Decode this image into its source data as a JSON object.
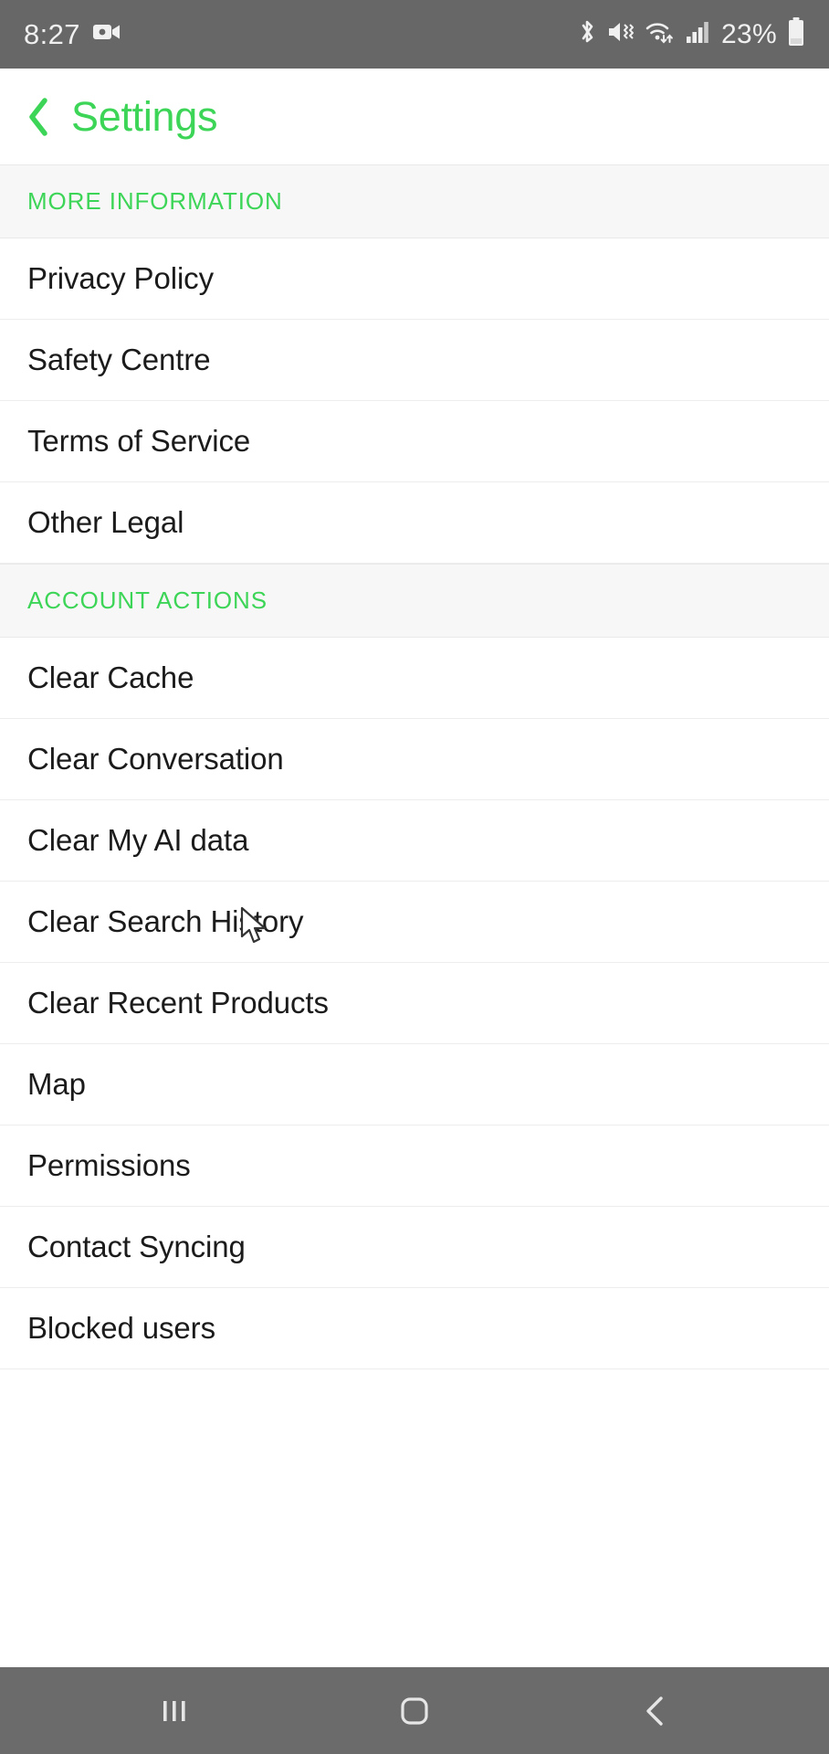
{
  "status_bar": {
    "time": "8:27",
    "battery_percent": "23%",
    "icons": [
      {
        "name": "screen-record-icon"
      },
      {
        "name": "bluetooth-icon"
      },
      {
        "name": "vibrate-mute-icon"
      },
      {
        "name": "wifi-transfer-icon"
      },
      {
        "name": "cellular-signal-icon"
      },
      {
        "name": "battery-icon"
      }
    ]
  },
  "header": {
    "title": "Settings",
    "back_icon": "chevron-left-icon",
    "accent_color": "#3dd557"
  },
  "sections": [
    {
      "heading": "MORE INFORMATION",
      "items": [
        {
          "label": "Privacy Policy"
        },
        {
          "label": "Safety Centre"
        },
        {
          "label": "Terms of Service"
        },
        {
          "label": "Other Legal"
        }
      ]
    },
    {
      "heading": "ACCOUNT ACTIONS",
      "items": [
        {
          "label": "Clear Cache"
        },
        {
          "label": "Clear Conversation"
        },
        {
          "label": "Clear My AI data"
        },
        {
          "label": "Clear Search History"
        },
        {
          "label": "Clear Recent Products"
        },
        {
          "label": "Map"
        },
        {
          "label": "Permissions"
        },
        {
          "label": "Contact Syncing"
        },
        {
          "label": "Blocked users"
        }
      ]
    }
  ],
  "nav_bar": {
    "buttons": [
      {
        "name": "recents-button",
        "icon": "recents-icon"
      },
      {
        "name": "home-button",
        "icon": "home-square-icon"
      },
      {
        "name": "back-button",
        "icon": "chevron-left-icon"
      }
    ]
  },
  "colors": {
    "accent_green": "#3dd557",
    "status_bar_bg": "#676767",
    "nav_bar_bg": "#6b6b6b",
    "section_bg": "#f6f7f6",
    "text": "#1b1b1b"
  }
}
